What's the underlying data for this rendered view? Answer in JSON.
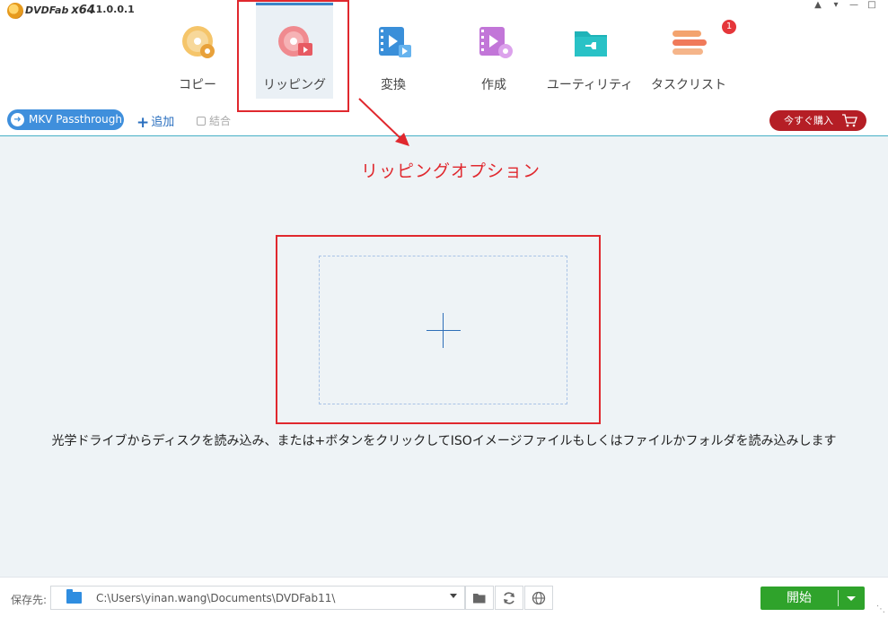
{
  "app": {
    "brand": "DVDFab",
    "arch": "x64",
    "version": "11.0.0.1"
  },
  "window_controls": [
    "shirt-icon",
    "dropdown-icon",
    "minimize-icon",
    "maximize-icon"
  ],
  "nav": {
    "items": [
      {
        "label": "コピー",
        "icon": "copy-disc-icon",
        "active": false
      },
      {
        "label": "リッピング",
        "icon": "ripping-disc-icon",
        "active": true
      },
      {
        "label": "変換",
        "icon": "convert-film-icon",
        "active": false
      },
      {
        "label": "作成",
        "icon": "creator-film-icon",
        "active": false
      },
      {
        "label": "ユーティリティ",
        "icon": "utility-folder-icon",
        "active": false
      },
      {
        "label": "タスクリスト",
        "icon": "tasklist-icon",
        "active": false,
        "badge": "1"
      }
    ]
  },
  "toolbar": {
    "mkv_label": "MKV Passthrough",
    "add_label": "追加",
    "merge_label": "結合",
    "buy_label": "今すぐ購入"
  },
  "annotation": {
    "label": "リッピングオプション",
    "color": "#e0282e"
  },
  "main": {
    "hint": "光学ドライブからディスクを読み込み、または+ボタンをクリックしてISOイメージファイルもしくはファイルかフォルダを読み込みします"
  },
  "bottom": {
    "save_label": "保存先:",
    "path": "C:\\Users\\yinan.wang\\Documents\\DVDFab11\\",
    "start_label": "開始"
  },
  "colors": {
    "accent_blue": "#3f8fdc",
    "buy_red": "#b51e25",
    "start_green": "#2fa32b"
  }
}
